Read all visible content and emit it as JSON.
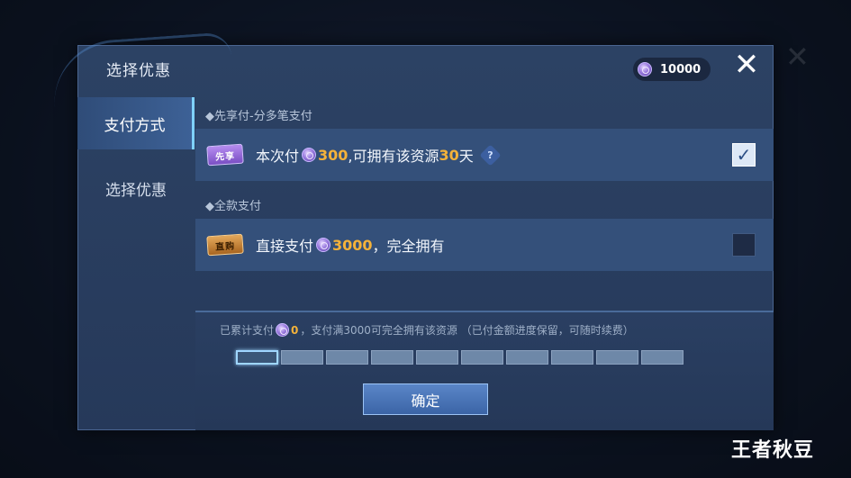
{
  "dialog": {
    "title": "选择优惠",
    "coins": "10000",
    "close_label": "✕"
  },
  "sidebar": {
    "items": [
      {
        "label": "支付方式",
        "active": true
      },
      {
        "label": "选择优惠",
        "active": false
      }
    ]
  },
  "sections": [
    {
      "label": "◆先享付-分多笔支付",
      "option": {
        "badge": "先享",
        "text_before": "本次付",
        "amount": "300",
        "text_mid": ",可拥有该资源",
        "days": "30",
        "text_after": "天",
        "help": "?",
        "checked": true,
        "check_mark": "✓"
      }
    },
    {
      "label": "◆全款支付",
      "option": {
        "badge": "直购",
        "text_before": "直接支付",
        "amount": "3000",
        "text_after": "，完全拥有",
        "checked": false
      }
    }
  ],
  "progress": {
    "prefix": "已累计支付",
    "paid": "0",
    "suffix": "，支付满3000可完全拥有该资源 （已付金额进度保留，可随时续费）",
    "segments_total": 10,
    "segments_filled": 0
  },
  "confirm_label": "确定",
  "watermark": "王者秋豆",
  "colors": {
    "accent_gold": "#f4b23a",
    "panel": "#2c4264",
    "row": "#34507a"
  }
}
